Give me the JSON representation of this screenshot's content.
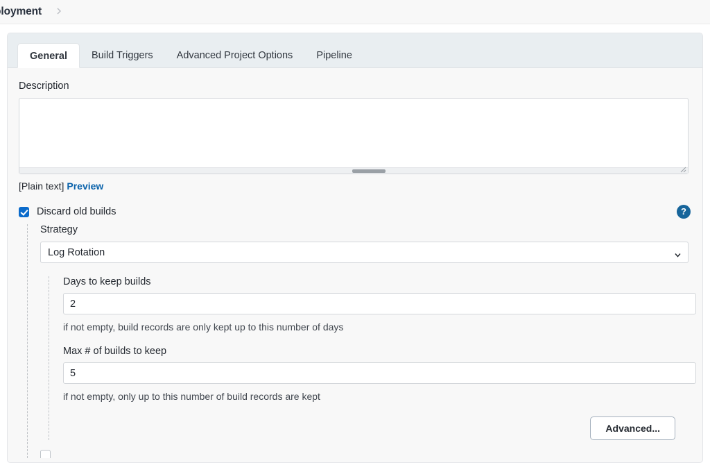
{
  "breadcrumb": {
    "current_label": "ployment",
    "separator_icon": "chevron-right-icon"
  },
  "tabs": [
    {
      "label": "General",
      "active": true
    },
    {
      "label": "Build Triggers",
      "active": false
    },
    {
      "label": "Advanced Project Options",
      "active": false
    },
    {
      "label": "Pipeline",
      "active": false
    }
  ],
  "description": {
    "label": "Description",
    "value": "",
    "placeholder": "",
    "markup_note": "[Plain text]",
    "preview_link": "Preview"
  },
  "discard_old_builds": {
    "label": "Discard old builds",
    "checked": true,
    "help_icon": "question-mark-icon",
    "help_label": "?"
  },
  "strategy": {
    "label": "Strategy",
    "selected": "Log Rotation",
    "options": [
      "Log Rotation"
    ],
    "chevron_icon": "chevron-down-icon"
  },
  "days_to_keep": {
    "label": "Days to keep builds",
    "value": "2",
    "hint": "if not empty, build records are only kept up to this number of days"
  },
  "max_builds_to_keep": {
    "label": "Max # of builds to keep",
    "value": "5",
    "hint": "if not empty, only up to this number of build records are kept"
  },
  "advanced_button": {
    "label": "Advanced..."
  },
  "colors": {
    "accent_blue": "#0b6bcb",
    "link_blue": "#0b63ab",
    "help_badge_blue": "#17659b",
    "tab_strip_bg": "#e9eef1",
    "page_bg": "#ffffff",
    "card_bg": "#f8f8f8"
  }
}
